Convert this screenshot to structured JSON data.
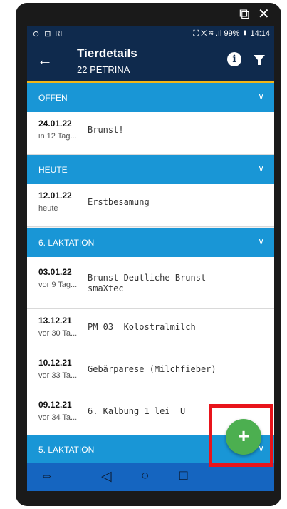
{
  "window_controls": {
    "restore_symbol": "⧉",
    "close_symbol": "✕"
  },
  "status_bar": {
    "left_icons": "⊙ ⊡ ⚿",
    "right_icons": "⛶ ✕ ≋ .ıl",
    "battery": "99%",
    "battery_icon": "▮",
    "time": "14:14"
  },
  "app_bar": {
    "back_icon": "←",
    "title": "Tierdetails",
    "subtitle": "22 PETRINA",
    "info_icon": "i",
    "filter_icon": "filter-icon"
  },
  "sections": [
    {
      "label": "OFFEN",
      "chevron": "∨"
    },
    {
      "label": "HEUTE",
      "chevron": "∨"
    },
    {
      "label": "6. LAKTATION",
      "chevron": "∨"
    },
    {
      "label": "5. LAKTATION",
      "chevron": "∨"
    }
  ],
  "events": [
    {
      "date": "24.01.22",
      "relative": "in 12 Tag...",
      "description": "Brunst!"
    },
    {
      "date": "12.01.22",
      "relative": "heute",
      "description": "Erstbesamung"
    },
    {
      "date": "03.01.22",
      "relative": "vor 9 Tag...",
      "description": "Brunst Deutliche Brunst\nsmaXtec"
    },
    {
      "date": "13.12.21",
      "relative": "vor 30 Ta...",
      "description": "PM 03  Kolostralmilch"
    },
    {
      "date": "10.12.21",
      "relative": "vor 33 Ta...",
      "description": "Gebärparese (Milchfieber)"
    },
    {
      "date": "09.12.21",
      "relative": "vor 34 Ta...",
      "description": "6. Kalbung 1 lei  U"
    }
  ],
  "fab": {
    "label": "+"
  },
  "nav_bar": {
    "app_icon": "⇔",
    "back": "◁",
    "home": "○",
    "recents": "□"
  },
  "colors": {
    "app_bar": "#0f2a4d",
    "accent_underline": "#f2b619",
    "section_header": "#1996d6",
    "fab": "#4caf50",
    "highlight_box": "#e8141b",
    "nav_bar": "#1565c0"
  }
}
